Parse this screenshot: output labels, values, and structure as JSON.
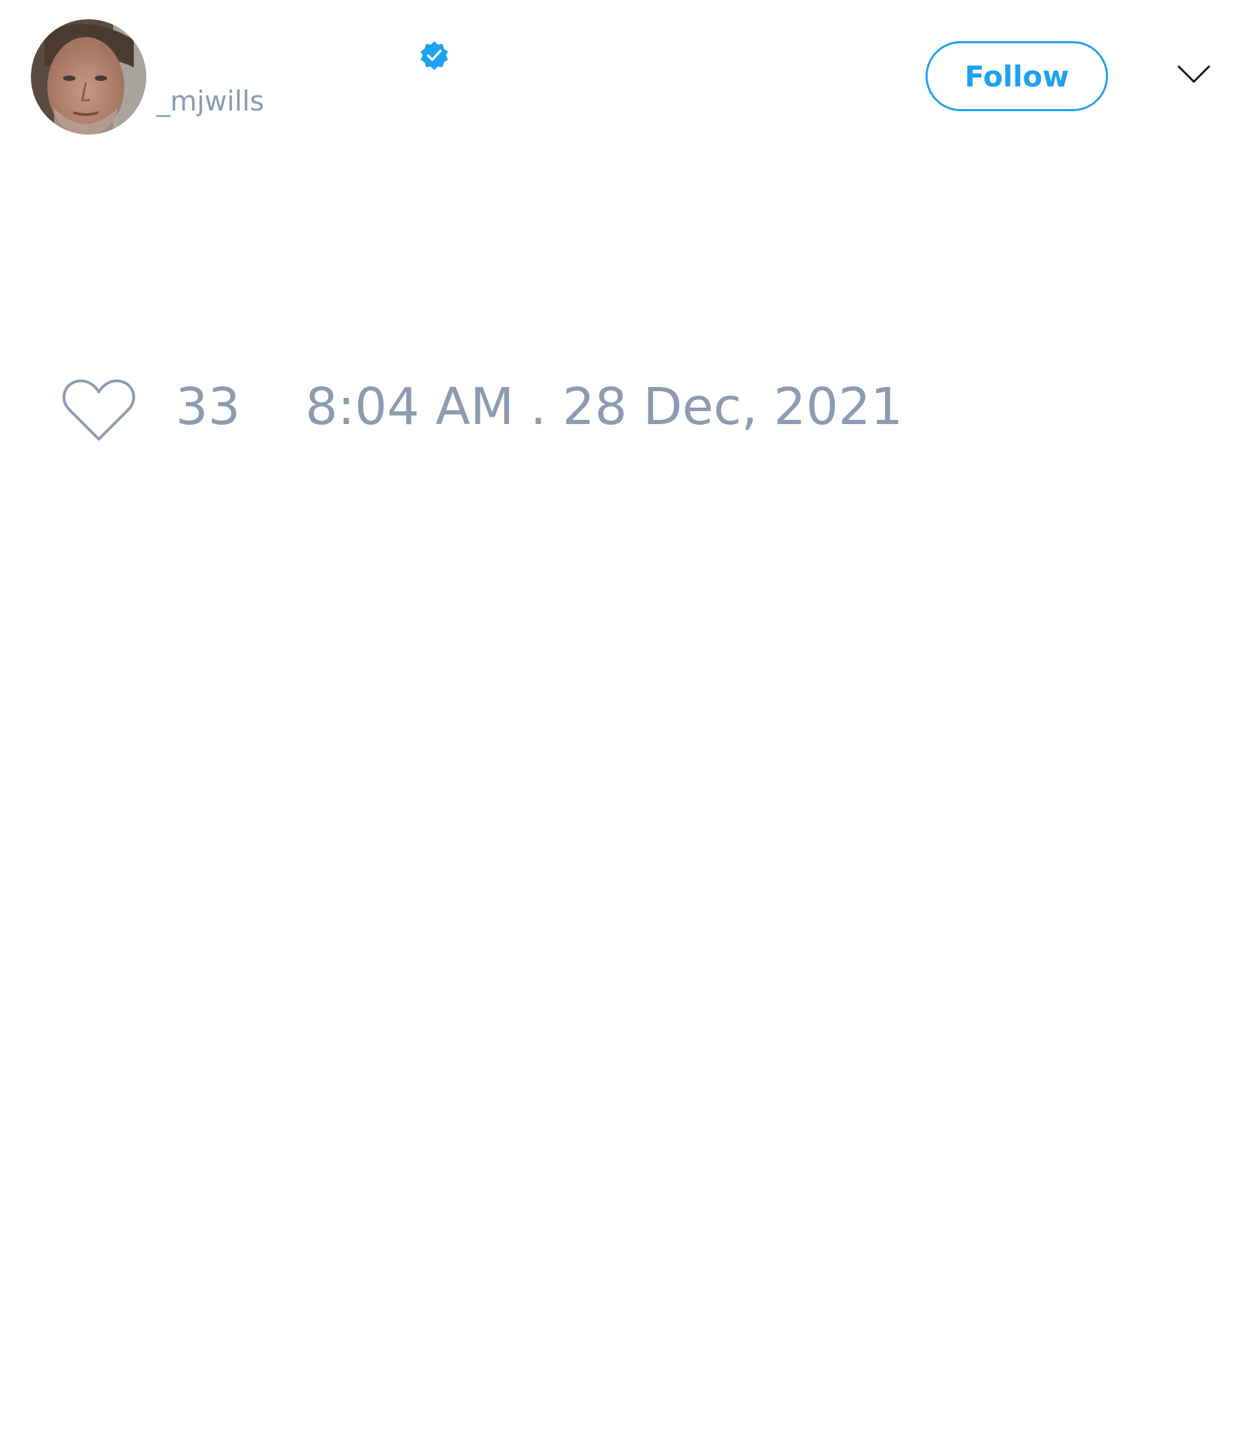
{
  "tweet": {
    "author": {
      "display_name": "",
      "handle": "_mjwills",
      "verified": true,
      "avatar_icon": "user-portrait-photo"
    },
    "follow_label": "Follow",
    "like_count": "33",
    "timestamp": "8:04 AM . 28 Dec, 2021"
  },
  "colors": {
    "accent": "#1da1f2",
    "muted": "#8b9bb0",
    "background": "#ffffff"
  },
  "icons": {
    "verified": "verified-badge-icon",
    "menu": "chevron-down-icon",
    "like": "heart-icon"
  }
}
